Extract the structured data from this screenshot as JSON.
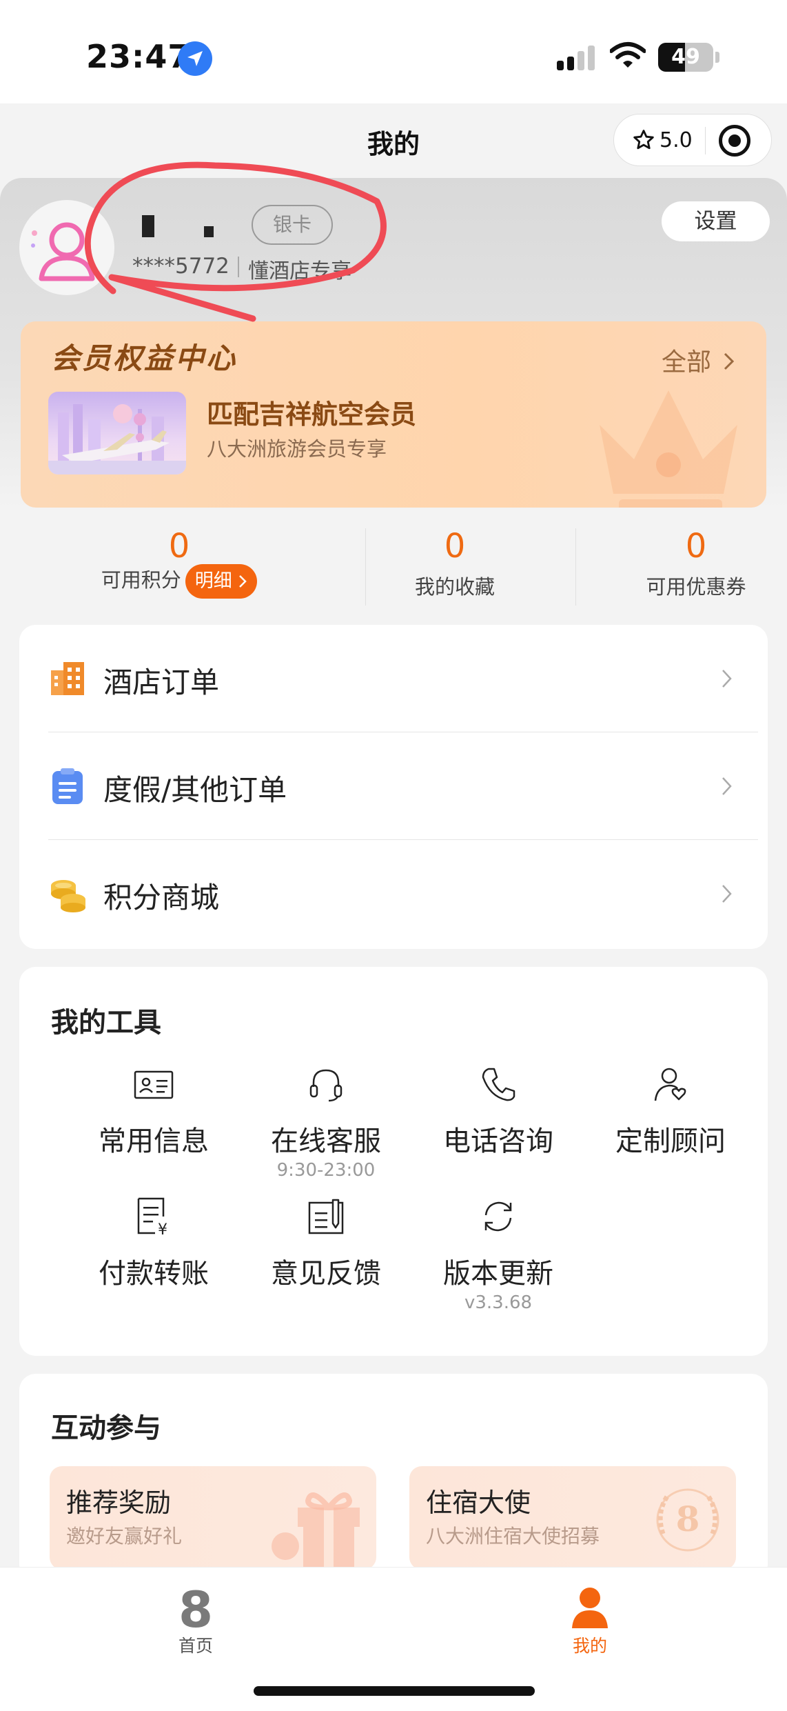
{
  "status_bar": {
    "time": "23:47",
    "battery": "49",
    "battery_level": 0.49
  },
  "nav": {
    "title": "我的",
    "rating": "5.0"
  },
  "profile": {
    "card_level": "银卡",
    "phone": "****5772",
    "member_tag": "懂酒店专享",
    "settings_label": "设置"
  },
  "benefits": {
    "title": "会员权益中心",
    "all_label": "全部",
    "promo_title": "匹配吉祥航空会员",
    "promo_subtitle": "八大洲旅游会员专享"
  },
  "stats": [
    {
      "value": "0",
      "label": "可用积分",
      "badge": "明细"
    },
    {
      "value": "0",
      "label": "我的收藏"
    },
    {
      "value": "0",
      "label": "可用优惠券"
    }
  ],
  "orders": [
    {
      "label": "酒店订单",
      "icon": "hotel-building-icon"
    },
    {
      "label": "度假/其他订单",
      "icon": "clipboard-icon"
    },
    {
      "label": "积分商城",
      "icon": "coins-icon"
    }
  ],
  "tools": {
    "title": "我的工具",
    "items": [
      {
        "label": "常用信息",
        "icon": "id-card-icon"
      },
      {
        "label": "在线客服",
        "sub": "9:30-23:00",
        "icon": "headset-icon"
      },
      {
        "label": "电话咨询",
        "icon": "phone-icon"
      },
      {
        "label": "定制顾问",
        "icon": "advisor-icon"
      },
      {
        "label": "付款转账",
        "icon": "payment-receipt-icon"
      },
      {
        "label": "意见反馈",
        "icon": "feedback-icon"
      },
      {
        "label": "版本更新",
        "sub": "v3.3.68",
        "icon": "refresh-icon"
      }
    ]
  },
  "interactive": {
    "title": "互动参与",
    "items": [
      {
        "title": "推荐奖励",
        "subtitle": "邀好友赢好礼"
      },
      {
        "title": "住宿大使",
        "subtitle": "八大洲住宿大使招募"
      }
    ]
  },
  "tabbar": [
    {
      "label": "首页",
      "icon": "home-logo-icon",
      "active": false
    },
    {
      "label": "我的",
      "icon": "profile-icon",
      "active": true
    }
  ],
  "colors": {
    "accent": "#f4650f",
    "stat_number": "#ef6a12",
    "benefits_text": "#8a4a14",
    "annotation": "#ef4b55"
  }
}
